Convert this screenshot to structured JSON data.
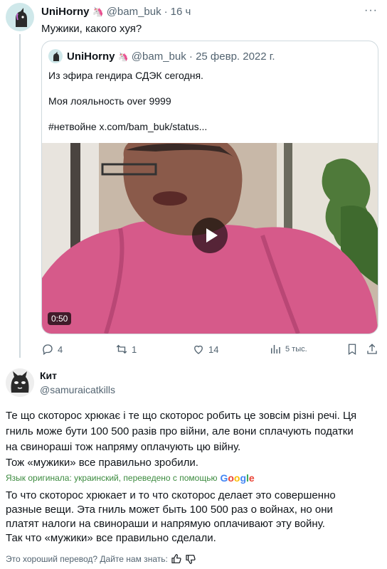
{
  "tweet": {
    "author_name": "UniHorny",
    "author_emoji": "🦄",
    "handle": "@bam_buk",
    "separator": "·",
    "time": "16 ч",
    "more": "···",
    "text": "Мужики, какого хуя?"
  },
  "quote": {
    "author_name": "UniHorny",
    "author_emoji": "🦄",
    "handle": "@bam_buk",
    "date": "· 25 февр. 2022 г.",
    "lines": [
      "Из эфира гендира СДЭК сегодня.",
      "Моя лояльность over 9999",
      "#нетвойне  x.com/bam_buk/status..."
    ],
    "video_duration": "0:50"
  },
  "actions": {
    "replies": "4",
    "retweets": "1",
    "likes": "14",
    "views": "5 тыс."
  },
  "reply": {
    "author_name": "Кит",
    "handle": "@samuraicatkills",
    "original_lines": [
      "Те що скоторос хрюкає і те що скоторос робить це зовсім різні речі. Ця",
      "гниль може бути 100 500 разів про війни, але вони сплачують податки",
      "на свинораші тож напряму оплачують цю війну.",
      "Тож «мужики» все правильно зробили."
    ],
    "translation_note_prefix": "Язык оригинала: украинский, переведено с помощью",
    "google_letters": [
      "G",
      "o",
      "o",
      "g",
      "l",
      "e"
    ],
    "translation_lines": [
      "То что скоторос хрюкает и то что скоторос делает это совершенно",
      "разные вещи. Эта гниль может быть 100 500 раз о войнах, но они",
      "платят налоги на свинораши и напрямую оплачивают эту войну.",
      "Так что «мужики» все правильно сделали."
    ],
    "feedback_prompt": "Это хороший перевод? Дайте нам знать:"
  },
  "colors": {
    "text": "#0f1419",
    "secondary": "#536471",
    "border": "#cfd9de",
    "translation_green": "#3b8a3e"
  }
}
